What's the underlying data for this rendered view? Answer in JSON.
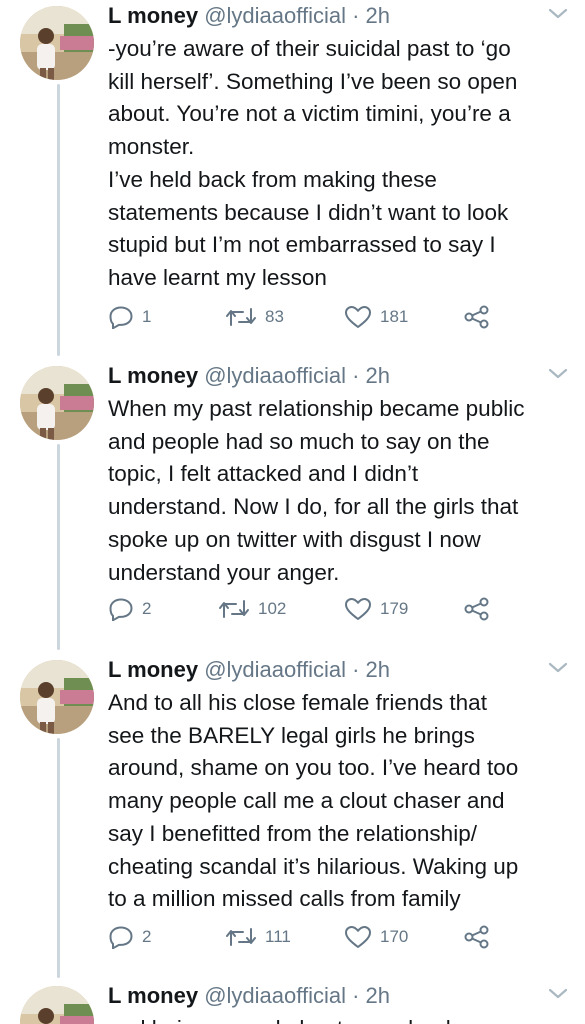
{
  "tweets": [
    {
      "name": "L money",
      "handle": "@lydiaaofficial",
      "dot": "·",
      "time": "2h",
      "lines": [
        "-you’re aware of their suicidal past to ‘go",
        "kill herself’. Something I’ve been so open",
        "about. You’re not a victim timini, you’re a",
        "monster.",
        "I’ve held back from making these",
        "statements because I didn’t want to look",
        "stupid but I’m not embarrassed to say I",
        "have learnt my lesson"
      ],
      "replies": "1",
      "retweets": "83",
      "likes": "181"
    },
    {
      "name": "L money",
      "handle": "@lydiaaofficial",
      "dot": "·",
      "time": "2h",
      "lines": [
        "When my past relationship became public",
        "and people had so much to say on the",
        "topic, I felt attacked and I didn’t",
        "understand. Now I do, for all the girls that",
        "spoke up on twitter with disgust I now",
        "understand your anger."
      ],
      "replies": "2",
      "retweets": "102",
      "likes": "179"
    },
    {
      "name": "L money",
      "handle": "@lydiaaofficial",
      "dot": "·",
      "time": "2h",
      "lines": [
        "And to all his close female friends that",
        "see the BARELY legal girls he brings",
        "around, shame on you too. I’ve heard too",
        "many people call me a clout chaser and",
        "say I benefitted from the relationship/",
        "cheating scandal it’s hilarious. Waking up",
        "to a million missed calls from family"
      ],
      "replies": "2",
      "retweets": "111",
      "likes": "170"
    },
    {
      "name": "L money",
      "handle": "@lydiaaofficial",
      "dot": "·",
      "time": "2h",
      "lines": [
        "and being scared about my school"
      ]
    }
  ],
  "icons": {
    "reply": "reply-icon",
    "retweet": "retweet-icon",
    "like": "like-icon",
    "share": "share-icon",
    "more": "chevron-down-icon"
  },
  "colors": {
    "text": "#14171a",
    "muted": "#657786",
    "thread": "#ccd6dd"
  }
}
